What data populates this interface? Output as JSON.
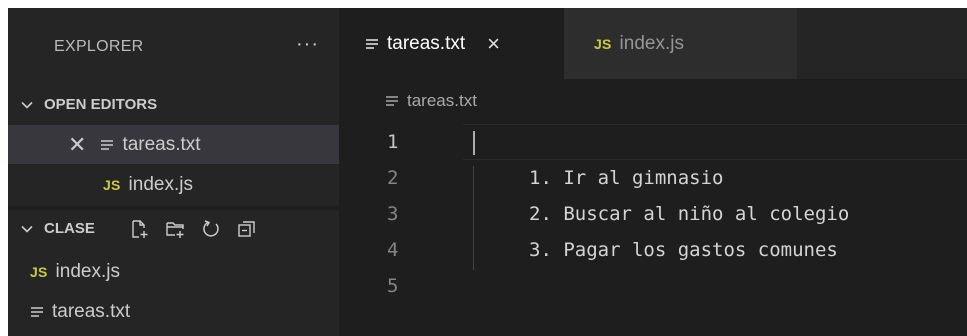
{
  "sidebar": {
    "title": "EXPLORER",
    "more_label": "···",
    "open_editors": {
      "label": "OPEN EDITORS",
      "items": [
        {
          "name": "tareas.txt",
          "icon": "text-file-icon",
          "selected": true
        },
        {
          "name": "index.js",
          "icon_label": "JS",
          "icon": "javascript-file-icon"
        }
      ]
    },
    "folder": {
      "label": "CLASE",
      "actions": [
        "new-file-icon",
        "new-folder-icon",
        "refresh-icon",
        "collapse-all-icon"
      ],
      "items": [
        {
          "name": "index.js",
          "icon_label": "JS",
          "icon": "javascript-file-icon"
        },
        {
          "name": "tareas.txt",
          "icon": "text-file-icon"
        }
      ]
    }
  },
  "tabs": [
    {
      "label": "tareas.txt",
      "active": true,
      "close_label": "×"
    },
    {
      "label": "index.js",
      "icon_label": "JS",
      "active": false
    }
  ],
  "breadcrumb": {
    "label": "tareas.txt"
  },
  "editor": {
    "lines": [
      {
        "number": "1",
        "text": ""
      },
      {
        "number": "2",
        "text": "1. Ir al gimnasio"
      },
      {
        "number": "3",
        "text": "2. Buscar al niño al colegio"
      },
      {
        "number": "4",
        "text": "3. Pagar los gastos comunes"
      },
      {
        "number": "5",
        "text": ""
      }
    ],
    "current_line": 1
  },
  "colors": {
    "sidebar_bg": "#252526",
    "editor_bg": "#1e1e1e",
    "selected_row": "#37373d",
    "js_icon": "#cbcb41"
  }
}
